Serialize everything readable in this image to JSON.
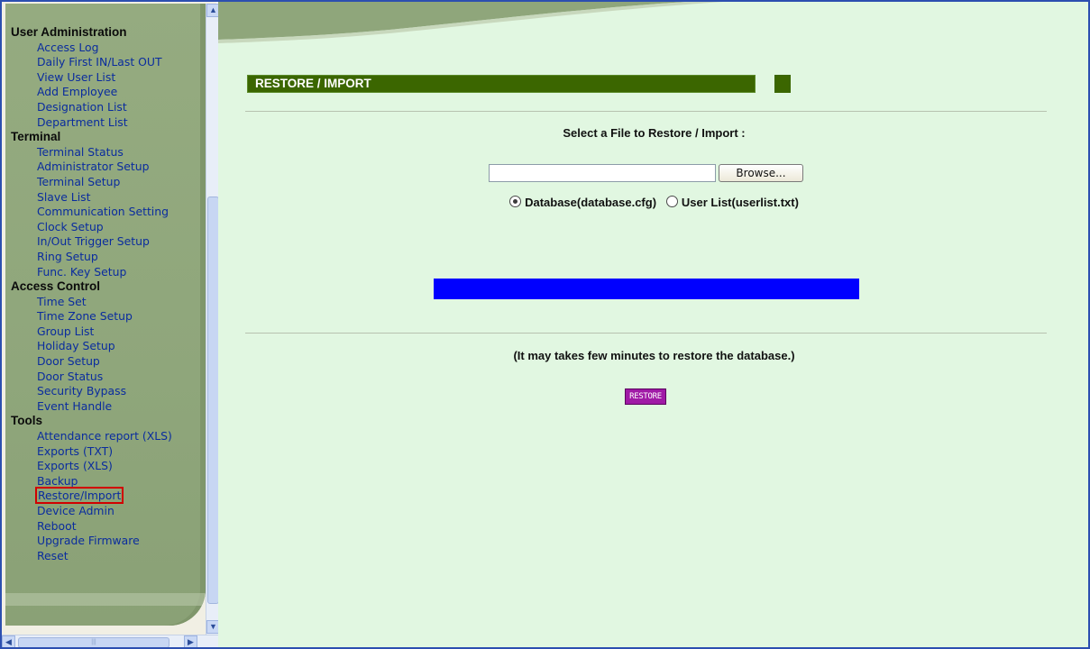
{
  "sidebar": {
    "sections": [
      {
        "title": "User Administration",
        "items": [
          "Access Log",
          "Daily First IN/Last OUT",
          "View User List",
          "Add Employee",
          "Designation List",
          "Department List"
        ]
      },
      {
        "title": "Terminal",
        "items": [
          "Terminal Status",
          "Administrator Setup",
          "Terminal Setup",
          "Slave List",
          "Communication Setting",
          "Clock Setup",
          "In/Out Trigger Setup",
          "Ring Setup",
          "Func. Key Setup"
        ]
      },
      {
        "title": "Access Control",
        "items": [
          "Time Set",
          "Time Zone Setup",
          "Group List",
          "Holiday Setup",
          "Door Setup",
          "Door Status",
          "Security Bypass",
          "Event Handle"
        ]
      },
      {
        "title": "Tools",
        "items": [
          "Attendance report (XLS)",
          "Exports (TXT)",
          "Exports (XLS)",
          "Backup",
          "Restore/Import",
          "Device Admin",
          "Reboot",
          "Upgrade Firmware",
          "Reset"
        ]
      }
    ],
    "active_item": "Restore/Import"
  },
  "main": {
    "title": "RESTORE / IMPORT",
    "select_label": "Select a File to Restore / Import :",
    "file_input_value": "",
    "browse_label": "Browse...",
    "radios": [
      {
        "label": "Database(database.cfg)",
        "checked": true
      },
      {
        "label": "User List(userlist.txt)",
        "checked": false
      }
    ],
    "progress_percent": 100,
    "note": "(It may takes few minutes to restore the database.)",
    "restore_label": "RESTORE"
  },
  "colors": {
    "sidebar_bg": "#8fa67b",
    "main_bg": "#e1f7e1",
    "title_bar": "#3b6600",
    "progress": "#0000ff",
    "restore_button": "#a01aa6",
    "active_outline": "#d10000",
    "link": "#0a2c9e"
  },
  "icons": [
    "scroll-up-arrow-icon",
    "scroll-down-arrow-icon",
    "scroll-left-arrow-icon",
    "scroll-right-arrow-icon"
  ]
}
